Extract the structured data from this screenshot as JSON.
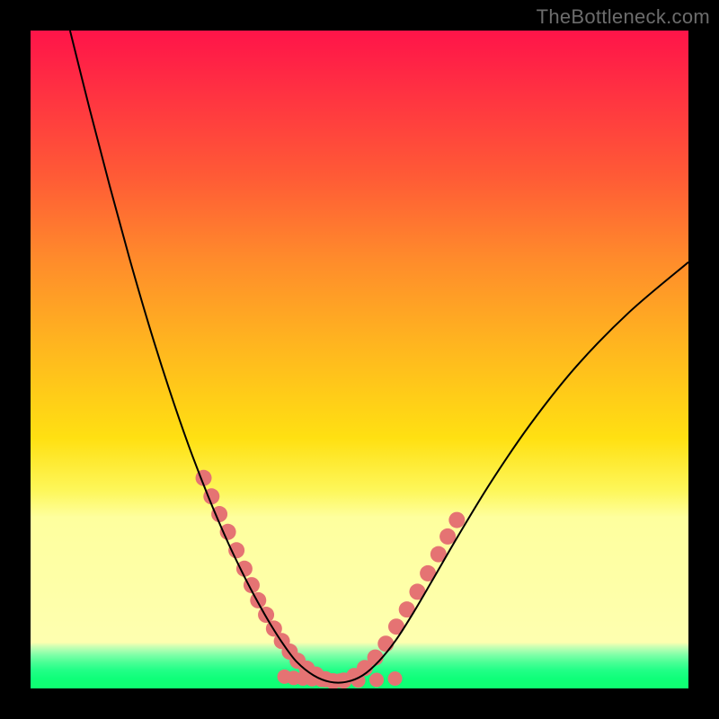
{
  "watermark": "TheBottleneck.com",
  "chart_data": {
    "type": "line",
    "title": "",
    "xlabel": "",
    "ylabel": "",
    "xlim": [
      0,
      1
    ],
    "ylim": [
      0,
      1
    ],
    "curve": {
      "name": "bottleneck-curve",
      "stroke": "#000000",
      "x": [
        0.06,
        0.09,
        0.12,
        0.15,
        0.18,
        0.21,
        0.24,
        0.27,
        0.3,
        0.325,
        0.345,
        0.365,
        0.385,
        0.405,
        0.43,
        0.455,
        0.48,
        0.505,
        0.53,
        0.555,
        0.58,
        0.61,
        0.65,
        0.7,
        0.76,
        0.83,
        0.91,
        1.0
      ],
      "y": [
        1.0,
        0.88,
        0.765,
        0.655,
        0.552,
        0.457,
        0.37,
        0.292,
        0.222,
        0.17,
        0.132,
        0.097,
        0.066,
        0.04,
        0.02,
        0.01,
        0.01,
        0.02,
        0.042,
        0.073,
        0.112,
        0.163,
        0.232,
        0.314,
        0.402,
        0.49,
        0.572,
        0.648
      ]
    },
    "highlight_left": {
      "name": "left-overlay-dots",
      "color": "#e57373",
      "x": [
        0.263,
        0.275,
        0.287,
        0.3,
        0.313,
        0.325,
        0.336,
        0.346,
        0.358,
        0.37,
        0.382,
        0.394,
        0.406,
        0.42,
        0.434,
        0.448
      ],
      "y": [
        0.32,
        0.292,
        0.265,
        0.238,
        0.21,
        0.182,
        0.157,
        0.134,
        0.112,
        0.091,
        0.072,
        0.056,
        0.042,
        0.03,
        0.021,
        0.014
      ]
    },
    "highlight_right": {
      "name": "right-overlay-dots",
      "color": "#e57373",
      "x": [
        0.46,
        0.476,
        0.492,
        0.508,
        0.524,
        0.54,
        0.556,
        0.572,
        0.588,
        0.604,
        0.62,
        0.634,
        0.648
      ],
      "y": [
        0.011,
        0.012,
        0.019,
        0.031,
        0.047,
        0.068,
        0.094,
        0.12,
        0.147,
        0.175,
        0.204,
        0.231,
        0.256
      ]
    },
    "highlight_bottom": {
      "name": "bottom-overlay-dots",
      "color": "#e57373",
      "x": [
        0.386,
        0.4,
        0.414,
        0.428,
        0.442,
        0.456,
        0.47,
        0.498,
        0.526,
        0.554
      ],
      "y": [
        0.018,
        0.016,
        0.015,
        0.014,
        0.013,
        0.012,
        0.012,
        0.012,
        0.013,
        0.015
      ]
    }
  }
}
